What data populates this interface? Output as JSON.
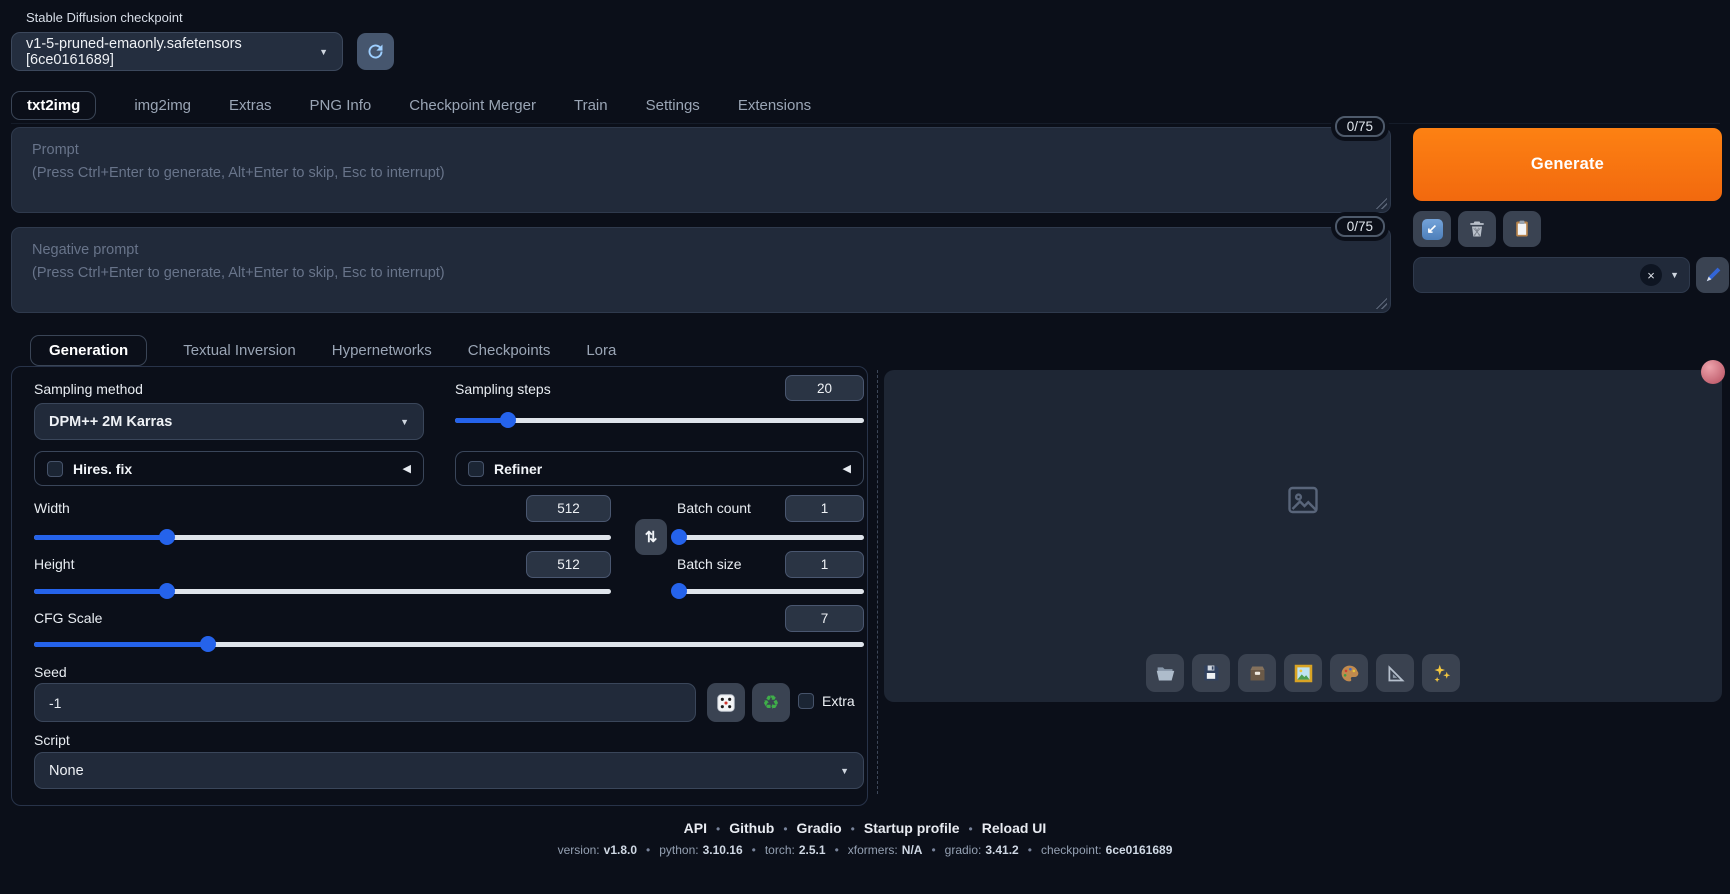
{
  "header": {
    "checkpoint_label": "Stable Diffusion checkpoint",
    "checkpoint_value": "v1-5-pruned-emaonly.safetensors [6ce0161689]",
    "refresh_icon": "refresh-arrows"
  },
  "main_tabs": {
    "items": [
      "txt2img",
      "img2img",
      "Extras",
      "PNG Info",
      "Checkpoint Merger",
      "Train",
      "Settings",
      "Extensions"
    ],
    "active": "txt2img"
  },
  "prompt": {
    "counter": "0/75",
    "value": "",
    "placeholder": "Prompt\n(Press Ctrl+Enter to generate, Alt+Enter to skip, Esc to interrupt)"
  },
  "negative_prompt": {
    "counter": "0/75",
    "value": "",
    "placeholder": "Negative prompt\n(Press Ctrl+Enter to generate, Alt+Enter to skip, Esc to interrupt)"
  },
  "generate": {
    "label": "Generate"
  },
  "toolbar": {
    "paste_icon": "arrow-down-left",
    "clear_icon": "trash",
    "apply_style_icon": "clipboard",
    "edit_styles_icon": "paintbrush",
    "styles_value": ""
  },
  "sub_tabs": {
    "items": [
      "Generation",
      "Textual Inversion",
      "Hypernetworks",
      "Checkpoints",
      "Lora"
    ],
    "active": "Generation"
  },
  "generation": {
    "sampling_method": {
      "label": "Sampling method",
      "value": "DPM++ 2M Karras"
    },
    "sampling_steps": {
      "label": "Sampling steps",
      "value": "20",
      "percent": 13
    },
    "hires_fix": {
      "label": "Hires. fix",
      "checked": false
    },
    "refiner": {
      "label": "Refiner",
      "checked": false
    },
    "width": {
      "label": "Width",
      "value": "512",
      "percent": 23
    },
    "height": {
      "label": "Height",
      "value": "512",
      "percent": 23
    },
    "batch_count": {
      "label": "Batch count",
      "value": "1",
      "percent": 1
    },
    "batch_size": {
      "label": "Batch size",
      "value": "1",
      "percent": 1
    },
    "cfg_scale": {
      "label": "CFG Scale",
      "value": "7",
      "percent": 21
    },
    "seed": {
      "label": "Seed",
      "value": "-1",
      "extra_label": "Extra",
      "dice_icon": "die",
      "reuse_icon": "recycle"
    },
    "script": {
      "label": "Script",
      "value": "None"
    },
    "swap_icon": "swap-arrows"
  },
  "output": {
    "placeholder_icon": "image-outline",
    "buttons": [
      "open-folder",
      "floppy-disk",
      "card-file-box",
      "framed-picture",
      "palette",
      "triangular-ruler",
      "sparkles"
    ]
  },
  "footer": {
    "links": [
      "API",
      "Github",
      "Gradio",
      "Startup profile",
      "Reload UI"
    ],
    "separator": "•",
    "version_items": [
      {
        "label": "version:",
        "value": "v1.8.0"
      },
      {
        "label": "python:",
        "value": "3.10.16"
      },
      {
        "label": "torch:",
        "value": "2.5.1"
      },
      {
        "label": "xformers:",
        "value": "N/A"
      },
      {
        "label": "gradio:",
        "value": "3.41.2"
      },
      {
        "label": "checkpoint:",
        "value": "6ce0161689"
      }
    ]
  },
  "colors": {
    "background": "#0b0f19",
    "accent_orange": "#f97316",
    "accent_blue": "#2563eb"
  }
}
